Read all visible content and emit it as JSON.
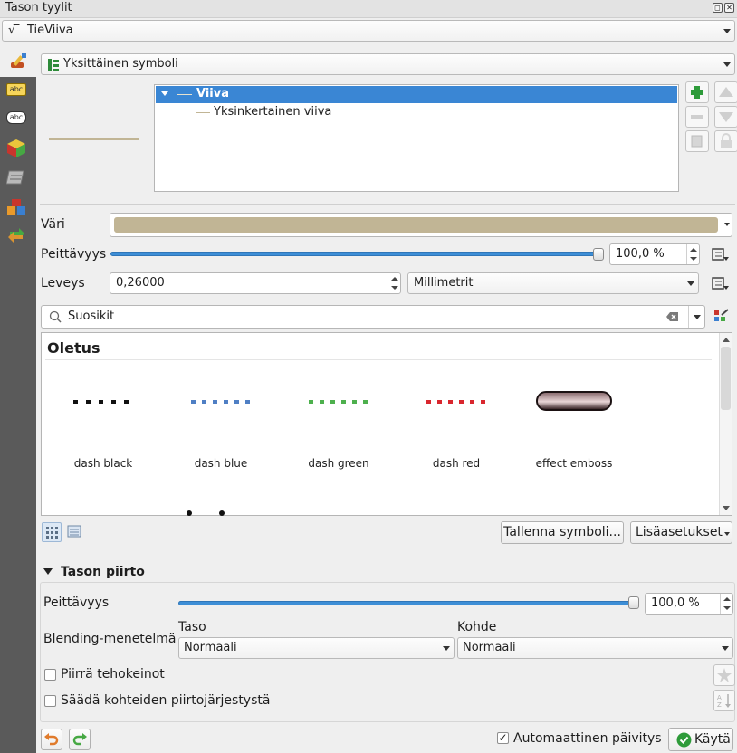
{
  "window": {
    "title": "Tason tyylit"
  },
  "layer_combo": {
    "value": "TieViiva"
  },
  "renderer_combo": {
    "value": "Yksittäinen symboli"
  },
  "symbol_tree": {
    "root": "Viiva",
    "child": "Yksinkertainen viiva"
  },
  "color_row": {
    "label": "Väri",
    "color": "#c1b595"
  },
  "opacity_row": {
    "label": "Peittävyys",
    "value": "100,0 %",
    "level": 1.0
  },
  "width_row": {
    "label": "Leveys",
    "value": "0,26000",
    "unit": "Millimetrit"
  },
  "search": {
    "value": "Suosikit"
  },
  "library": {
    "group": "Oletus",
    "symbols": [
      {
        "label": "dash  black",
        "color": "#111111"
      },
      {
        "label": "dash blue",
        "color": "#4f7fc4"
      },
      {
        "label": "dash green",
        "color": "#4db04d"
      },
      {
        "label": "dash red",
        "color": "#d9262e"
      },
      {
        "label": "effect emboss",
        "color": "#3a2628"
      }
    ]
  },
  "buttons": {
    "save_symbol": "Tallenna symboli...",
    "advanced": "Lisäasetukset",
    "apply": "Käytä"
  },
  "layer_rendering": {
    "title": "Tason piirto",
    "opacity_label": "Peittävyys",
    "opacity_value": "100,0 %",
    "opacity_level": 1.0,
    "blending_label": "Blending-menetelmä",
    "layer_label": "Taso",
    "layer_value": "Normaali",
    "feature_label": "Kohde",
    "feature_value": "Normaali",
    "draw_effects": "Piirrä tehokeinot",
    "control_order": "Säädä kohteiden piirtojärjestystä"
  },
  "footer": {
    "auto_update": "Automaattinen päivitys",
    "auto_update_checked": true
  }
}
